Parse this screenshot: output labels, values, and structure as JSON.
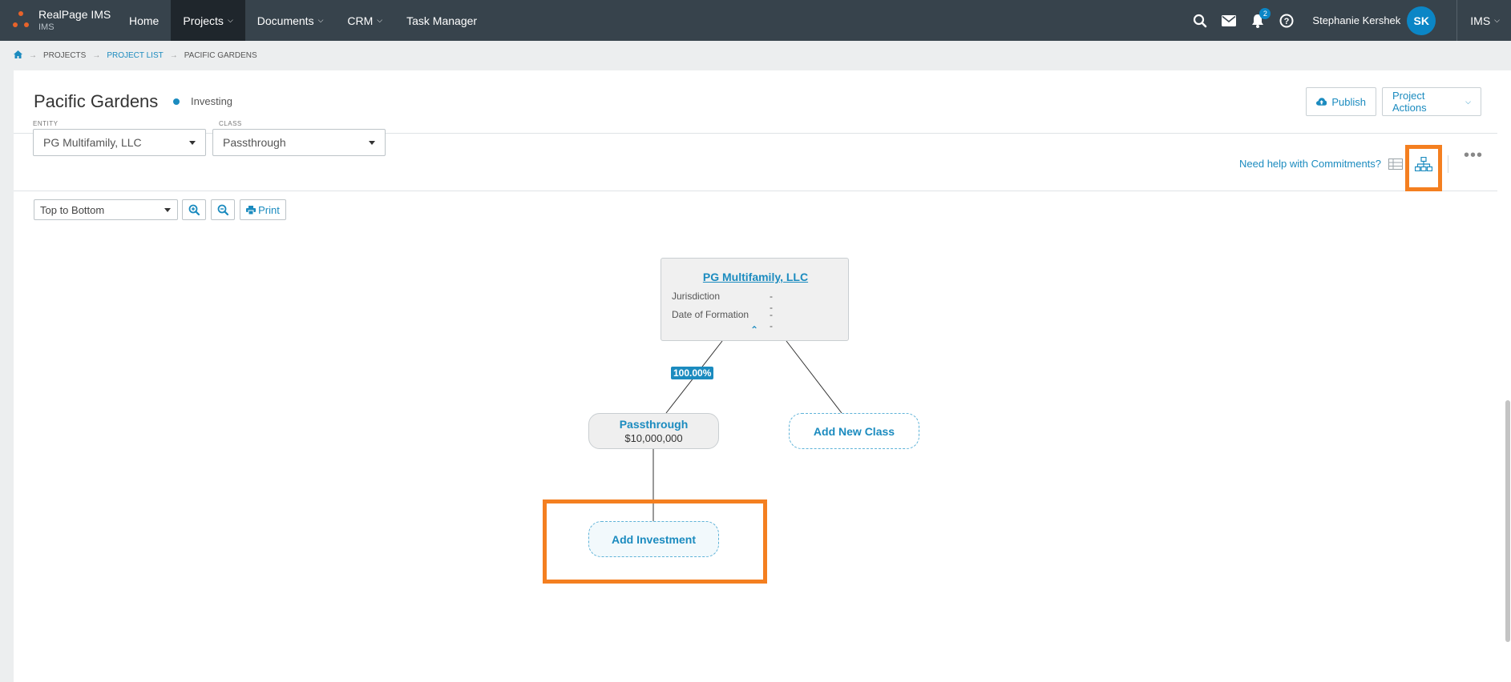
{
  "brand": {
    "name": "RealPage IMS",
    "sub": "IMS"
  },
  "nav": {
    "items": [
      {
        "label": "Home",
        "active": false,
        "dropdown": false
      },
      {
        "label": "Projects",
        "active": true,
        "dropdown": true
      },
      {
        "label": "Documents",
        "active": false,
        "dropdown": true
      },
      {
        "label": "CRM",
        "active": false,
        "dropdown": true
      },
      {
        "label": "Task Manager",
        "active": false,
        "dropdown": false
      }
    ],
    "notifications_count": "2",
    "user_name": "Stephanie Kershek",
    "user_initials": "SK",
    "app_menu": "IMS"
  },
  "breadcrumb": {
    "home_icon": "home-icon",
    "items": [
      "PROJECTS",
      "PROJECT LIST",
      "PACIFIC GARDENS"
    ]
  },
  "page": {
    "title": "Pacific Gardens",
    "status": "Investing",
    "publish_label": "Publish",
    "actions_label": "Project Actions"
  },
  "filters": {
    "entity_label": "ENTITY",
    "entity_value": "PG Multifamily, LLC",
    "class_label": "CLASS",
    "class_value": "Passthrough",
    "help_link": "Need help with Commitments?"
  },
  "toolbar": {
    "direction": "Top to Bottom",
    "print_label": "Print"
  },
  "org_chart": {
    "entity": {
      "name": "PG Multifamily, LLC",
      "jurisdiction_label": "Jurisdiction",
      "jurisdiction_value": "- -",
      "formation_label": "Date of Formation",
      "formation_value": "- -"
    },
    "ownership_pct": "100.00%",
    "class_node": {
      "name": "Passthrough",
      "amount": "$10,000,000"
    },
    "add_class_label": "Add New Class",
    "add_investment_label": "Add Investment"
  },
  "colors": {
    "accent": "#1b8bbf",
    "nav_bg": "#37434c",
    "highlight": "#f47f20",
    "brand": "#e8632a"
  }
}
